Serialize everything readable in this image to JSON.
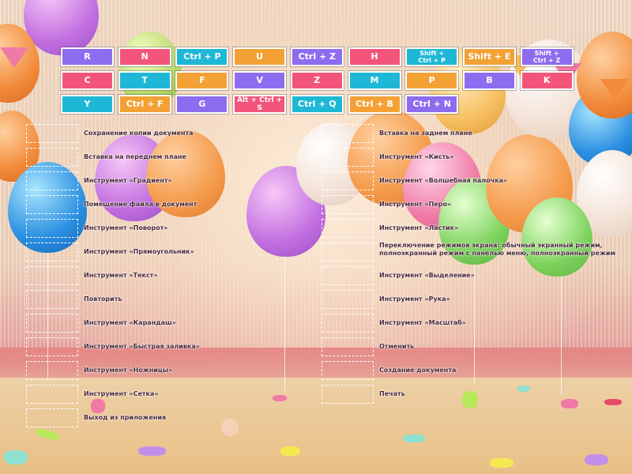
{
  "colors": {
    "purple": "#8e6cf0",
    "pink": "#f3557a",
    "teal": "#1fb7d6",
    "orange": "#f3a135"
  },
  "tiles": [
    {
      "text": "R",
      "color": "purple"
    },
    {
      "text": "N",
      "color": "pink"
    },
    {
      "text": "Ctrl + P",
      "color": "teal"
    },
    {
      "text": "U",
      "color": "orange"
    },
    {
      "text": "Ctrl + Z",
      "color": "purple"
    },
    {
      "text": "H",
      "color": "pink"
    },
    {
      "text": "Shift + Ctrl + P",
      "color": "teal",
      "line1": "Shift +",
      "line2": "Ctrl + P"
    },
    {
      "text": "Shift + E",
      "color": "orange"
    },
    {
      "text": "Shift + Ctrl + Z",
      "color": "purple",
      "line1": "Shift +",
      "line2": "Ctrl + Z"
    },
    {
      "text": "C",
      "color": "pink"
    },
    {
      "text": "T",
      "color": "teal"
    },
    {
      "text": "F",
      "color": "orange"
    },
    {
      "text": "V",
      "color": "purple"
    },
    {
      "text": "Z",
      "color": "pink"
    },
    {
      "text": "M",
      "color": "teal"
    },
    {
      "text": "P",
      "color": "orange"
    },
    {
      "text": "B",
      "color": "purple"
    },
    {
      "text": "K",
      "color": "pink"
    },
    {
      "text": "Y",
      "color": "teal"
    },
    {
      "text": "Ctrl + F",
      "color": "orange"
    },
    {
      "text": "G",
      "color": "purple"
    },
    {
      "text": "Alt + Ctrl + S",
      "color": "pink"
    },
    {
      "text": "Ctrl + Q",
      "color": "teal"
    },
    {
      "text": "Ctrl + B",
      "color": "orange"
    },
    {
      "text": "Ctrl + N",
      "color": "purple"
    }
  ],
  "left_targets": [
    "Сохранение копии документа",
    "Вставка на переднем плане",
    "Инструмент «Градиент»",
    "Помещение файла в документ",
    "Инструмент «Поворот»",
    "Инструмент «Прямоугольник»",
    "Инструмент «Текст»",
    "Повторить",
    "Инструмент «Карандаш»",
    "Инструмент «Быстрая заливка»",
    "Инструмент «Ножницы»",
    "Инструмент «Сетка»",
    "Выход из приложения"
  ],
  "right_targets": [
    "Вставка на заднем плане",
    "Инструмент «Кисть»",
    "Инструмент «Волшебная палочка»",
    "Инструмент «Перо»",
    "Инструмент «Ластик»",
    "Переключение режимов экрана: обычный экранный режим, полноэкранный режим с панелью меню, полноэкранный режим",
    "Инструмент «Выделение»",
    "Инструмент «Рука»",
    "Инструмент «Масштаб»",
    "Отменить",
    "Создание документа",
    "Печать"
  ]
}
